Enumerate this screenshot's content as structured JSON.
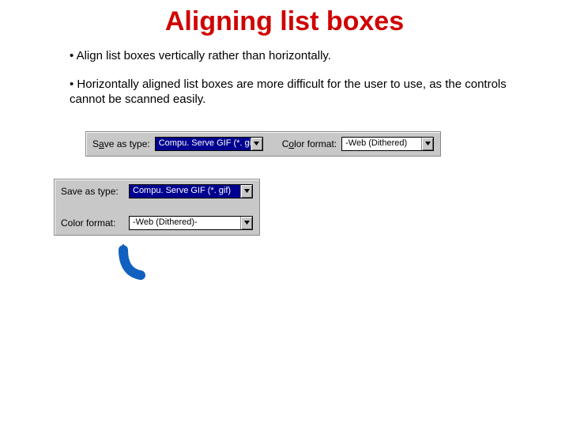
{
  "title": "Aligning list boxes",
  "bullets": [
    "Align  list boxes vertically rather than horizontally.",
    "Horizontally aligned list boxes are more difficult for the user to use, as the controls cannot be scanned easily."
  ],
  "example1": {
    "save_label_pre": "S",
    "save_label_mid": "a",
    "save_label_post": "ve as type:",
    "save_value": "Compu. Serve GIF (*. gif)",
    "color_label_pre": "C",
    "color_label_mid": "o",
    "color_label_post": "lor format:",
    "color_value": "-Web (Dithered)"
  },
  "example2": {
    "save_label": "Save as type:",
    "save_value": "Compu. Serve GIF (*. gif)",
    "color_label": "Color format:",
    "color_value": "-Web (Dithered)-"
  },
  "icons": {
    "dropdown": "chevron-down-icon",
    "arrow": "curved-up-arrow-icon"
  }
}
